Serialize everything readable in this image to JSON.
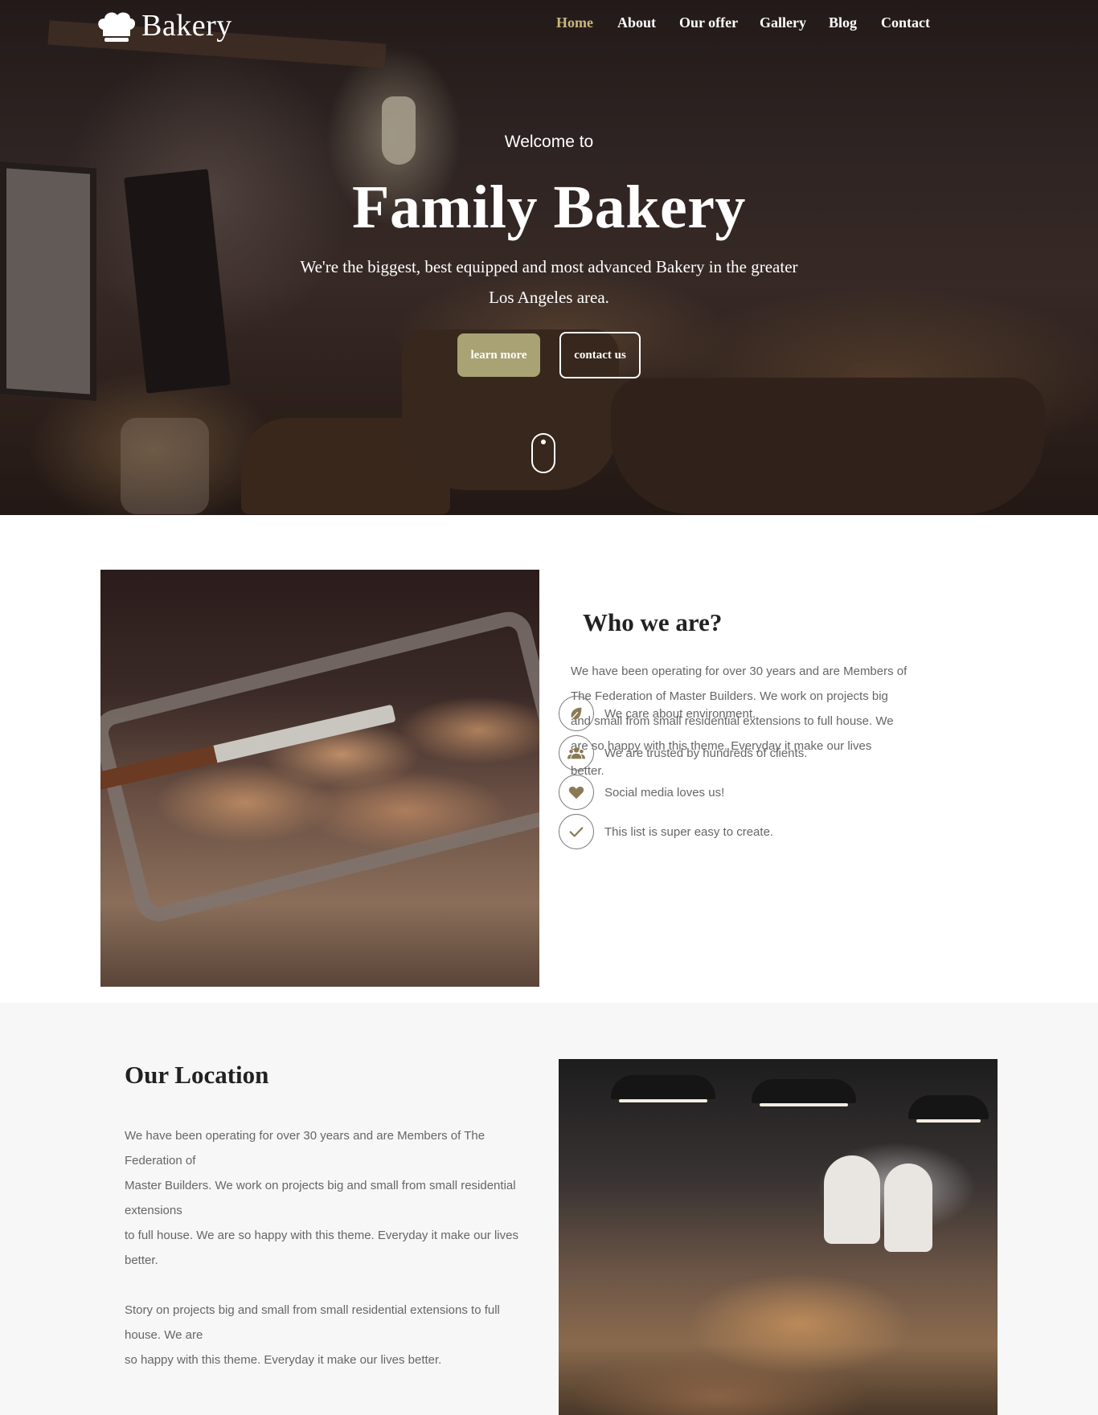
{
  "brand": {
    "name": "Bakery"
  },
  "nav": {
    "items": [
      {
        "label": "Home",
        "active": true
      },
      {
        "label": "About",
        "active": false
      },
      {
        "label": "Our offer",
        "active": false
      },
      {
        "label": "Gallery",
        "active": false
      },
      {
        "label": "Blog",
        "active": false
      },
      {
        "label": "Contact",
        "active": false
      }
    ]
  },
  "hero": {
    "subtitle": "Welcome to",
    "title": "Family Bakery",
    "description": "We're the biggest, best equipped and most advanced Bakery in the greater Los Angeles area.",
    "learn_more": "learn more",
    "contact_us": "contact us"
  },
  "who": {
    "title": "Who we are?",
    "text": "We have been operating for over 30 years and are Members of The Federation of Master Builders. We work on projects big and small from small residential extensions to full house. We are so happy with this theme. Everyday it make our lives better.",
    "features": [
      {
        "icon": "leaf-icon",
        "label": "We care about environment."
      },
      {
        "icon": "users-icon",
        "label": "We are trusted by hundreds of clients."
      },
      {
        "icon": "heart-icon",
        "label": "Social media loves us!"
      },
      {
        "icon": "check-icon",
        "label": "This list is super easy to create."
      }
    ]
  },
  "location": {
    "title": "Our Location",
    "paragraph1": "We have been operating for over 30 years and are Members of The Federation of\nMaster Builders. We work on projects big and small from small residential extensions\nto full house. We are so happy with this theme. Everyday it make our lives better.",
    "paragraph2": "Story on projects big and small from small residential extensions to full house. We are\nso happy with this theme. Everyday it make our lives better."
  },
  "colors": {
    "accent": "#c9b780",
    "button": "#a8a274",
    "icon": "#8a7a56"
  }
}
